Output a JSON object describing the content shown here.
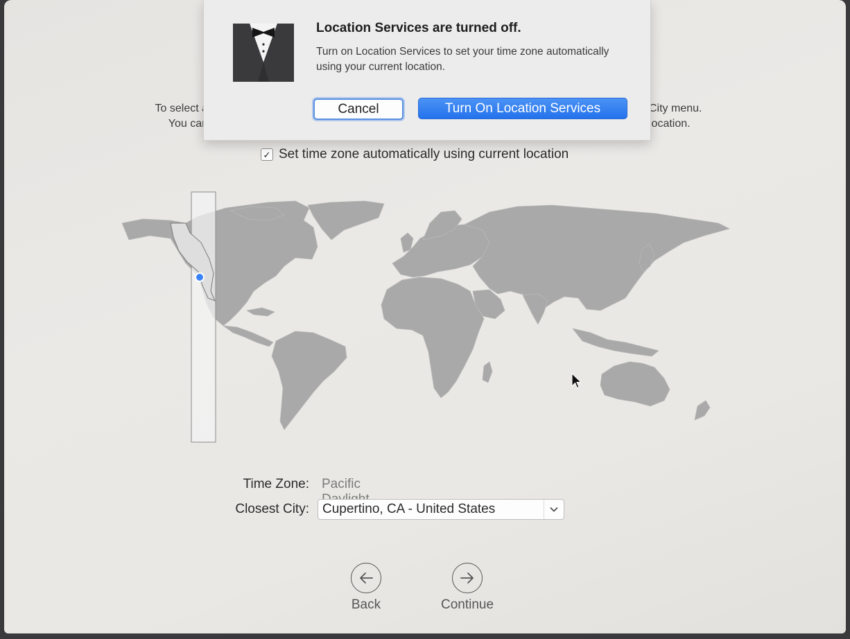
{
  "dialog": {
    "title": "Location Services are turned off.",
    "message": "Turn on Location Services to set your time zone automatically using your current location.",
    "cancel_label": "Cancel",
    "confirm_label": "Turn On Location Services"
  },
  "intro": {
    "left_line1": "To select a",
    "left_line2": "You can",
    "right_line1": "City menu.",
    "right_line2": "location."
  },
  "auto_timezone": {
    "checked": true,
    "check_glyph": "✓",
    "label": "Set time zone automatically using current location"
  },
  "map": {
    "selected_zone": "Pacific",
    "land_color": "#a9a9a9",
    "highlight_color": "#f2f2f2",
    "location_dot_color": "#3b82f6"
  },
  "timezone": {
    "label": "Time Zone:",
    "value": "Pacific Daylight Time"
  },
  "closest_city": {
    "label": "Closest City:",
    "value": "Cupertino, CA - United States"
  },
  "navigation": {
    "back_label": "Back",
    "continue_label": "Continue"
  },
  "icons": {
    "dialog_icon": "setup-assistant-tuxedo-icon",
    "back": "arrow-left-circle-icon",
    "continue": "arrow-right-circle-icon",
    "dropdown": "chevron-down-icon",
    "cursor": "mouse-pointer-icon"
  }
}
